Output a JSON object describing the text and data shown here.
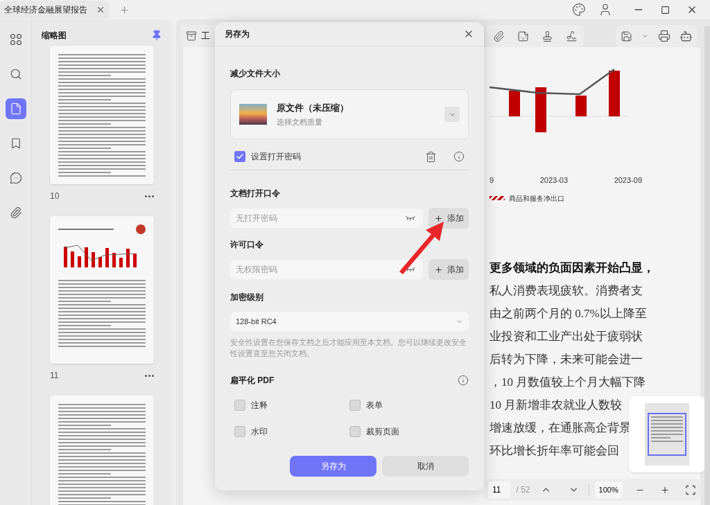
{
  "tab_bar": {
    "tabs": [
      {
        "label": "全球经济金融展望报告",
        "selected": true
      }
    ]
  },
  "sidebar": {
    "title": "缩略图",
    "pinned": true,
    "rail": [
      {
        "kind": "grid",
        "selected": false
      },
      {
        "kind": "search",
        "selected": false
      },
      {
        "kind": "pages",
        "selected": true
      },
      {
        "kind": "bookmark",
        "selected": false
      },
      {
        "kind": "comment",
        "selected": false
      },
      {
        "kind": "attachment",
        "selected": false
      }
    ],
    "thumbnails": [
      {
        "label": "10",
        "kind": "text"
      },
      {
        "label": "11",
        "kind": "chart"
      },
      {
        "kind": "text"
      }
    ]
  },
  "toolbar": {
    "tools_label": "工"
  },
  "document": {
    "x_labels": [
      "9",
      "2023-03",
      "2023-09"
    ],
    "legend": "商品和服务净出口",
    "lines": [
      {
        "text": "更多领域的负面因素开始凸显，",
        "bold": true
      },
      {
        "text": "私人消费表现疲软。消费者支",
        "bold": false
      },
      {
        "text": "由之前两个月的 0.7%以上降至",
        "bold": false
      },
      {
        "text": "业投资和工业产出处于疲弱状",
        "bold": false
      },
      {
        "text": "后转为下降，未来可能会进一",
        "bold": false
      },
      {
        "text": "，10 月数值较上个月大幅下降",
        "bold": false
      },
      {
        "text": "10 月新增非农就业人数较",
        "bold": false
      },
      {
        "text": "增速放缓，在通胀高企背景",
        "bold": false
      },
      {
        "text": "环比增长折年率可能会回",
        "bold": false
      }
    ]
  },
  "page_nav": {
    "page": "11",
    "total": "/ 52",
    "zoom": "100%"
  },
  "dialog": {
    "title": "另存为",
    "compress": {
      "heading": "减少文件大小",
      "option": "原文件（未压缩）",
      "hint": "选择文档质量"
    },
    "password_toggle": {
      "label": "设置打开密码",
      "checked": true
    },
    "fields": [
      {
        "label": "文档打开口令",
        "placeholder": "无打开密码",
        "button": "添加"
      },
      {
        "label": "许可口令",
        "placeholder": "无权限密码",
        "button": "添加"
      }
    ],
    "encryption": {
      "label": "加密级别",
      "value": "128-bit RC4",
      "note": "安全性设置在您保存文档之后才能应用至本文档。您可以继续更改安全性设置直至您关闭文档。"
    },
    "flatten": {
      "heading": "扁平化 PDF",
      "options": [
        {
          "label": "注释",
          "checked": false
        },
        {
          "label": "表单",
          "checked": false
        },
        {
          "label": "水印",
          "checked": false
        },
        {
          "label": "裁剪页面",
          "checked": false
        }
      ]
    },
    "buttons": [
      {
        "label": "另存为",
        "kind": "primary"
      },
      {
        "label": "取消",
        "kind": "secondary"
      }
    ]
  }
}
